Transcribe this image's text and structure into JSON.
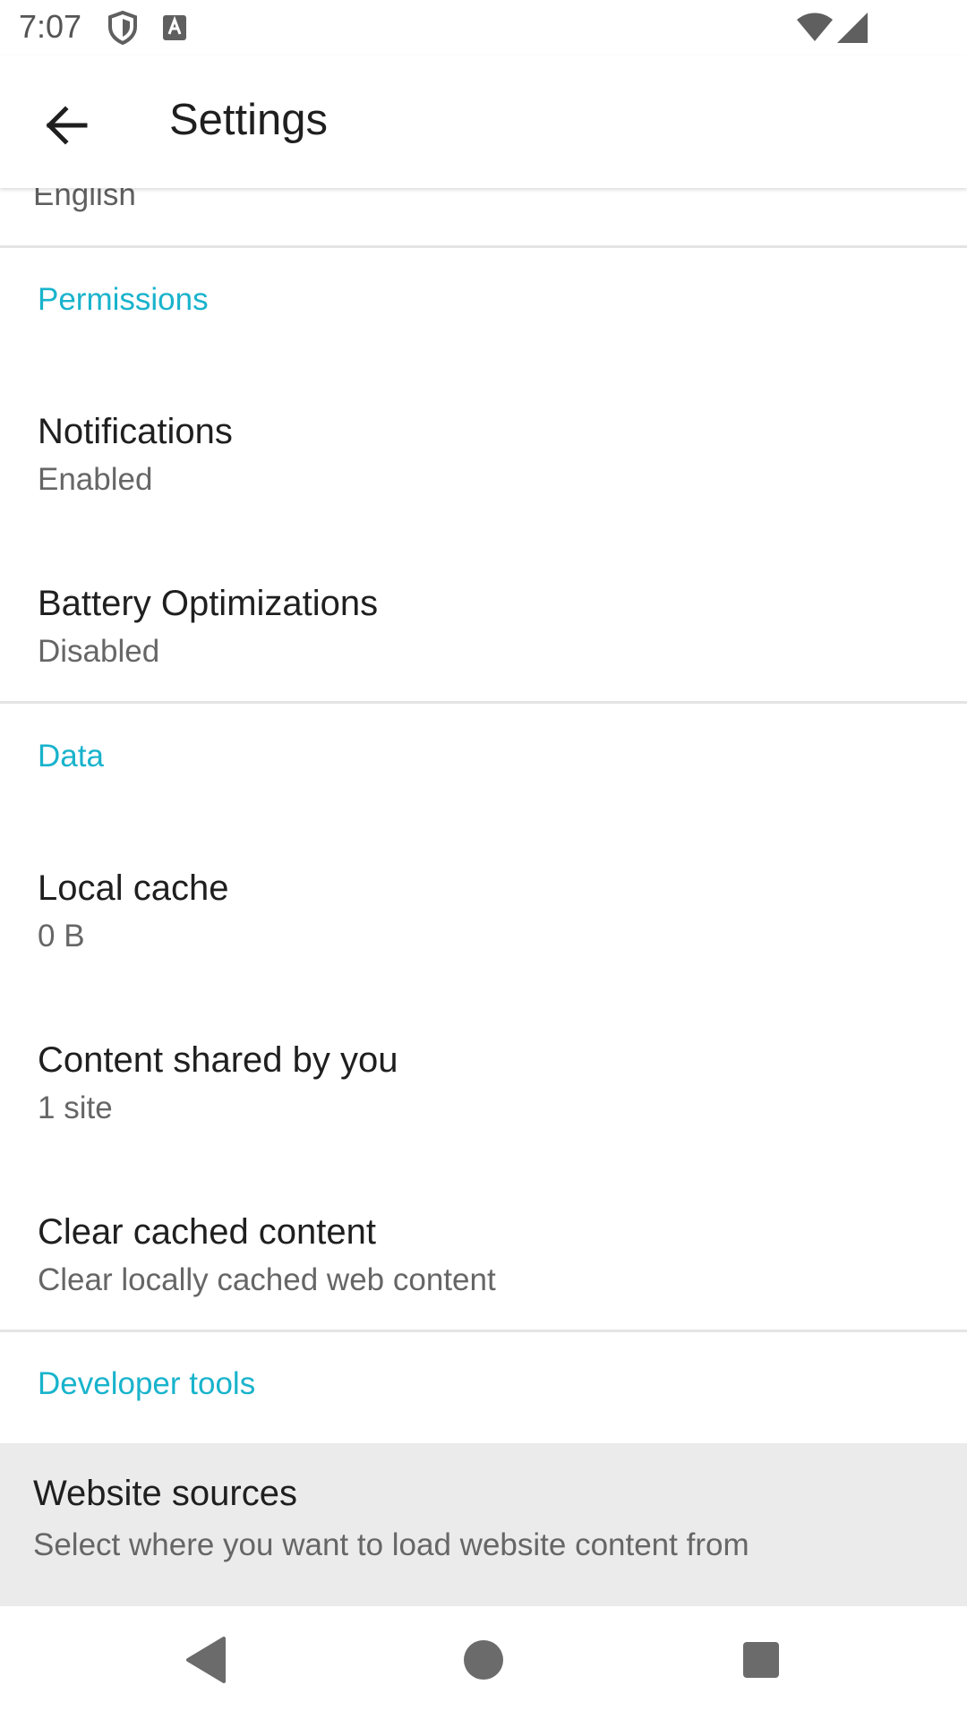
{
  "status_bar": {
    "time": "7:07",
    "icons": [
      "shield-icon",
      "keyboard-a-icon",
      "wifi-icon",
      "cellular-signal-icon"
    ]
  },
  "app_bar": {
    "back_icon": "arrow-back-icon",
    "title": "Settings"
  },
  "settings": {
    "partial_value": "English",
    "permissions": {
      "header": "Permissions",
      "items": [
        {
          "title": "Notifications",
          "summary": "Enabled"
        },
        {
          "title": "Battery Optimizations",
          "summary": "Disabled"
        }
      ]
    },
    "data": {
      "header": "Data",
      "items": [
        {
          "title": "Local cache",
          "summary": "0 B"
        },
        {
          "title": "Content shared by you",
          "summary": "1 site"
        },
        {
          "title": "Clear cached content",
          "summary": "Clear locally cached web content"
        }
      ]
    },
    "developer_tools": {
      "header": "Developer tools",
      "items": [
        {
          "title": "Website sources",
          "summary": "Select where you want to load website content from"
        }
      ]
    }
  },
  "nav_bar": {
    "icons": [
      "back-triangle-icon",
      "home-circle-icon",
      "recents-square-icon"
    ]
  },
  "colors": {
    "accent": "#19b3cc",
    "pressed_background": "#ebebeb",
    "divider": "#e4e4e4"
  }
}
